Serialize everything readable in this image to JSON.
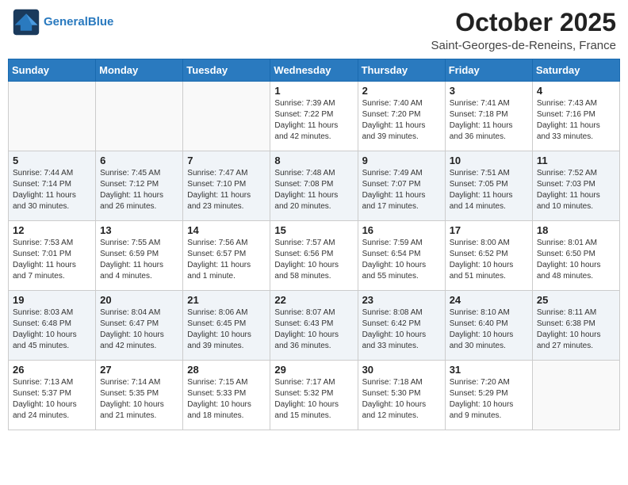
{
  "header": {
    "logo_line1": "General",
    "logo_line2": "Blue",
    "month": "October 2025",
    "location": "Saint-Georges-de-Reneins, France"
  },
  "days_of_week": [
    "Sunday",
    "Monday",
    "Tuesday",
    "Wednesday",
    "Thursday",
    "Friday",
    "Saturday"
  ],
  "weeks": [
    [
      {
        "day": "",
        "info": ""
      },
      {
        "day": "",
        "info": ""
      },
      {
        "day": "",
        "info": ""
      },
      {
        "day": "1",
        "info": "Sunrise: 7:39 AM\nSunset: 7:22 PM\nDaylight: 11 hours\nand 42 minutes."
      },
      {
        "day": "2",
        "info": "Sunrise: 7:40 AM\nSunset: 7:20 PM\nDaylight: 11 hours\nand 39 minutes."
      },
      {
        "day": "3",
        "info": "Sunrise: 7:41 AM\nSunset: 7:18 PM\nDaylight: 11 hours\nand 36 minutes."
      },
      {
        "day": "4",
        "info": "Sunrise: 7:43 AM\nSunset: 7:16 PM\nDaylight: 11 hours\nand 33 minutes."
      }
    ],
    [
      {
        "day": "5",
        "info": "Sunrise: 7:44 AM\nSunset: 7:14 PM\nDaylight: 11 hours\nand 30 minutes."
      },
      {
        "day": "6",
        "info": "Sunrise: 7:45 AM\nSunset: 7:12 PM\nDaylight: 11 hours\nand 26 minutes."
      },
      {
        "day": "7",
        "info": "Sunrise: 7:47 AM\nSunset: 7:10 PM\nDaylight: 11 hours\nand 23 minutes."
      },
      {
        "day": "8",
        "info": "Sunrise: 7:48 AM\nSunset: 7:08 PM\nDaylight: 11 hours\nand 20 minutes."
      },
      {
        "day": "9",
        "info": "Sunrise: 7:49 AM\nSunset: 7:07 PM\nDaylight: 11 hours\nand 17 minutes."
      },
      {
        "day": "10",
        "info": "Sunrise: 7:51 AM\nSunset: 7:05 PM\nDaylight: 11 hours\nand 14 minutes."
      },
      {
        "day": "11",
        "info": "Sunrise: 7:52 AM\nSunset: 7:03 PM\nDaylight: 11 hours\nand 10 minutes."
      }
    ],
    [
      {
        "day": "12",
        "info": "Sunrise: 7:53 AM\nSunset: 7:01 PM\nDaylight: 11 hours\nand 7 minutes."
      },
      {
        "day": "13",
        "info": "Sunrise: 7:55 AM\nSunset: 6:59 PM\nDaylight: 11 hours\nand 4 minutes."
      },
      {
        "day": "14",
        "info": "Sunrise: 7:56 AM\nSunset: 6:57 PM\nDaylight: 11 hours\nand 1 minute."
      },
      {
        "day": "15",
        "info": "Sunrise: 7:57 AM\nSunset: 6:56 PM\nDaylight: 10 hours\nand 58 minutes."
      },
      {
        "day": "16",
        "info": "Sunrise: 7:59 AM\nSunset: 6:54 PM\nDaylight: 10 hours\nand 55 minutes."
      },
      {
        "day": "17",
        "info": "Sunrise: 8:00 AM\nSunset: 6:52 PM\nDaylight: 10 hours\nand 51 minutes."
      },
      {
        "day": "18",
        "info": "Sunrise: 8:01 AM\nSunset: 6:50 PM\nDaylight: 10 hours\nand 48 minutes."
      }
    ],
    [
      {
        "day": "19",
        "info": "Sunrise: 8:03 AM\nSunset: 6:48 PM\nDaylight: 10 hours\nand 45 minutes."
      },
      {
        "day": "20",
        "info": "Sunrise: 8:04 AM\nSunset: 6:47 PM\nDaylight: 10 hours\nand 42 minutes."
      },
      {
        "day": "21",
        "info": "Sunrise: 8:06 AM\nSunset: 6:45 PM\nDaylight: 10 hours\nand 39 minutes."
      },
      {
        "day": "22",
        "info": "Sunrise: 8:07 AM\nSunset: 6:43 PM\nDaylight: 10 hours\nand 36 minutes."
      },
      {
        "day": "23",
        "info": "Sunrise: 8:08 AM\nSunset: 6:42 PM\nDaylight: 10 hours\nand 33 minutes."
      },
      {
        "day": "24",
        "info": "Sunrise: 8:10 AM\nSunset: 6:40 PM\nDaylight: 10 hours\nand 30 minutes."
      },
      {
        "day": "25",
        "info": "Sunrise: 8:11 AM\nSunset: 6:38 PM\nDaylight: 10 hours\nand 27 minutes."
      }
    ],
    [
      {
        "day": "26",
        "info": "Sunrise: 7:13 AM\nSunset: 5:37 PM\nDaylight: 10 hours\nand 24 minutes."
      },
      {
        "day": "27",
        "info": "Sunrise: 7:14 AM\nSunset: 5:35 PM\nDaylight: 10 hours\nand 21 minutes."
      },
      {
        "day": "28",
        "info": "Sunrise: 7:15 AM\nSunset: 5:33 PM\nDaylight: 10 hours\nand 18 minutes."
      },
      {
        "day": "29",
        "info": "Sunrise: 7:17 AM\nSunset: 5:32 PM\nDaylight: 10 hours\nand 15 minutes."
      },
      {
        "day": "30",
        "info": "Sunrise: 7:18 AM\nSunset: 5:30 PM\nDaylight: 10 hours\nand 12 minutes."
      },
      {
        "day": "31",
        "info": "Sunrise: 7:20 AM\nSunset: 5:29 PM\nDaylight: 10 hours\nand 9 minutes."
      },
      {
        "day": "",
        "info": ""
      }
    ]
  ]
}
